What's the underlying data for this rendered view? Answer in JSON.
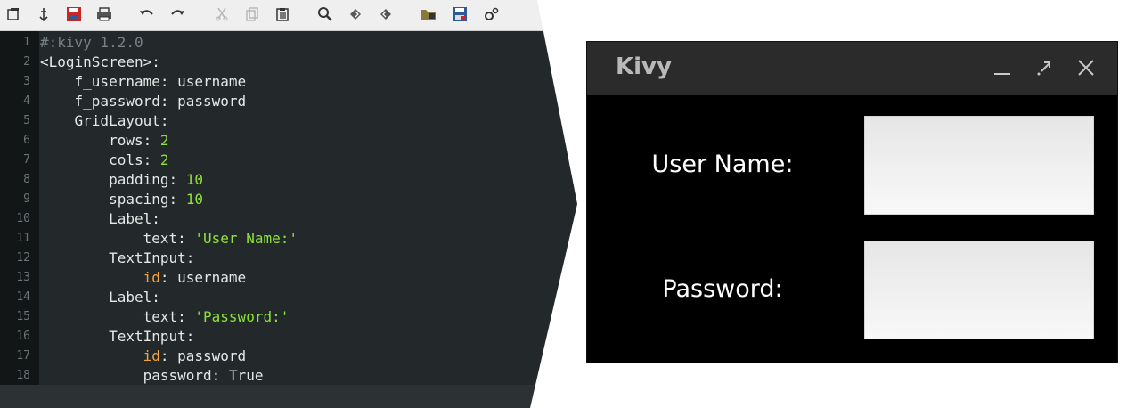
{
  "editor": {
    "toolbar": {
      "icons": [
        "new-window-icon",
        "move-icon",
        "save-icon",
        "print-icon",
        "undo-icon",
        "redo-icon",
        "cut-icon",
        "copy-icon",
        "paste-icon",
        "find-icon",
        "find-next-icon",
        "find-previous-icon",
        "open-folder-icon",
        "save-as-icon",
        "settings-icon"
      ]
    },
    "line_numbers": [
      "1",
      "2",
      "3",
      "4",
      "5",
      "6",
      "7",
      "8",
      "9",
      "10",
      "11",
      "12",
      "13",
      "14",
      "15",
      "16",
      "17",
      "18"
    ],
    "code": [
      {
        "indent": "",
        "parts": [
          {
            "t": "#:kivy 1.2.0",
            "c": "cmt"
          }
        ]
      },
      {
        "indent": "",
        "parts": [
          {
            "t": "<LoginScreen>:",
            "c": ""
          }
        ]
      },
      {
        "indent": "    ",
        "parts": [
          {
            "t": "f_username: username",
            "c": ""
          }
        ]
      },
      {
        "indent": "    ",
        "parts": [
          {
            "t": "f_password: password",
            "c": ""
          }
        ]
      },
      {
        "indent": "    ",
        "parts": [
          {
            "t": "GridLayout:",
            "c": ""
          }
        ]
      },
      {
        "indent": "        ",
        "parts": [
          {
            "t": "rows: ",
            "c": ""
          },
          {
            "t": "2",
            "c": "num"
          }
        ]
      },
      {
        "indent": "        ",
        "parts": [
          {
            "t": "cols: ",
            "c": ""
          },
          {
            "t": "2",
            "c": "num"
          }
        ]
      },
      {
        "indent": "        ",
        "parts": [
          {
            "t": "padding: ",
            "c": ""
          },
          {
            "t": "10",
            "c": "num"
          }
        ]
      },
      {
        "indent": "        ",
        "parts": [
          {
            "t": "spacing: ",
            "c": ""
          },
          {
            "t": "10",
            "c": "num"
          }
        ]
      },
      {
        "indent": "        ",
        "parts": [
          {
            "t": "Label:",
            "c": ""
          }
        ]
      },
      {
        "indent": "            ",
        "parts": [
          {
            "t": "text: ",
            "c": ""
          },
          {
            "t": "'User Name:'",
            "c": "str"
          }
        ]
      },
      {
        "indent": "        ",
        "parts": [
          {
            "t": "TextInput:",
            "c": ""
          }
        ]
      },
      {
        "indent": "            ",
        "parts": [
          {
            "t": "id",
            "c": "kw"
          },
          {
            "t": ": username",
            "c": ""
          }
        ]
      },
      {
        "indent": "        ",
        "parts": [
          {
            "t": "Label:",
            "c": ""
          }
        ]
      },
      {
        "indent": "            ",
        "parts": [
          {
            "t": "text: ",
            "c": ""
          },
          {
            "t": "'Password:'",
            "c": "str"
          }
        ]
      },
      {
        "indent": "        ",
        "parts": [
          {
            "t": "TextInput:",
            "c": ""
          }
        ]
      },
      {
        "indent": "            ",
        "parts": [
          {
            "t": "id",
            "c": "kw"
          },
          {
            "t": ": password",
            "c": ""
          }
        ]
      },
      {
        "indent": "            ",
        "parts": [
          {
            "t": "password: True",
            "c": ""
          }
        ]
      }
    ],
    "colors": {
      "background": "#23292b",
      "gutter": "#121617",
      "number": "#8ee13a",
      "string": "#8ee13a",
      "keyword": "#f4a340",
      "comment": "#778087"
    }
  },
  "kivy_window": {
    "title": "Kivy",
    "controls": [
      "minimize-icon",
      "maximize-icon",
      "close-icon"
    ],
    "username_label": "User Name:",
    "password_label": "Password:",
    "username_value": "",
    "password_value": ""
  }
}
